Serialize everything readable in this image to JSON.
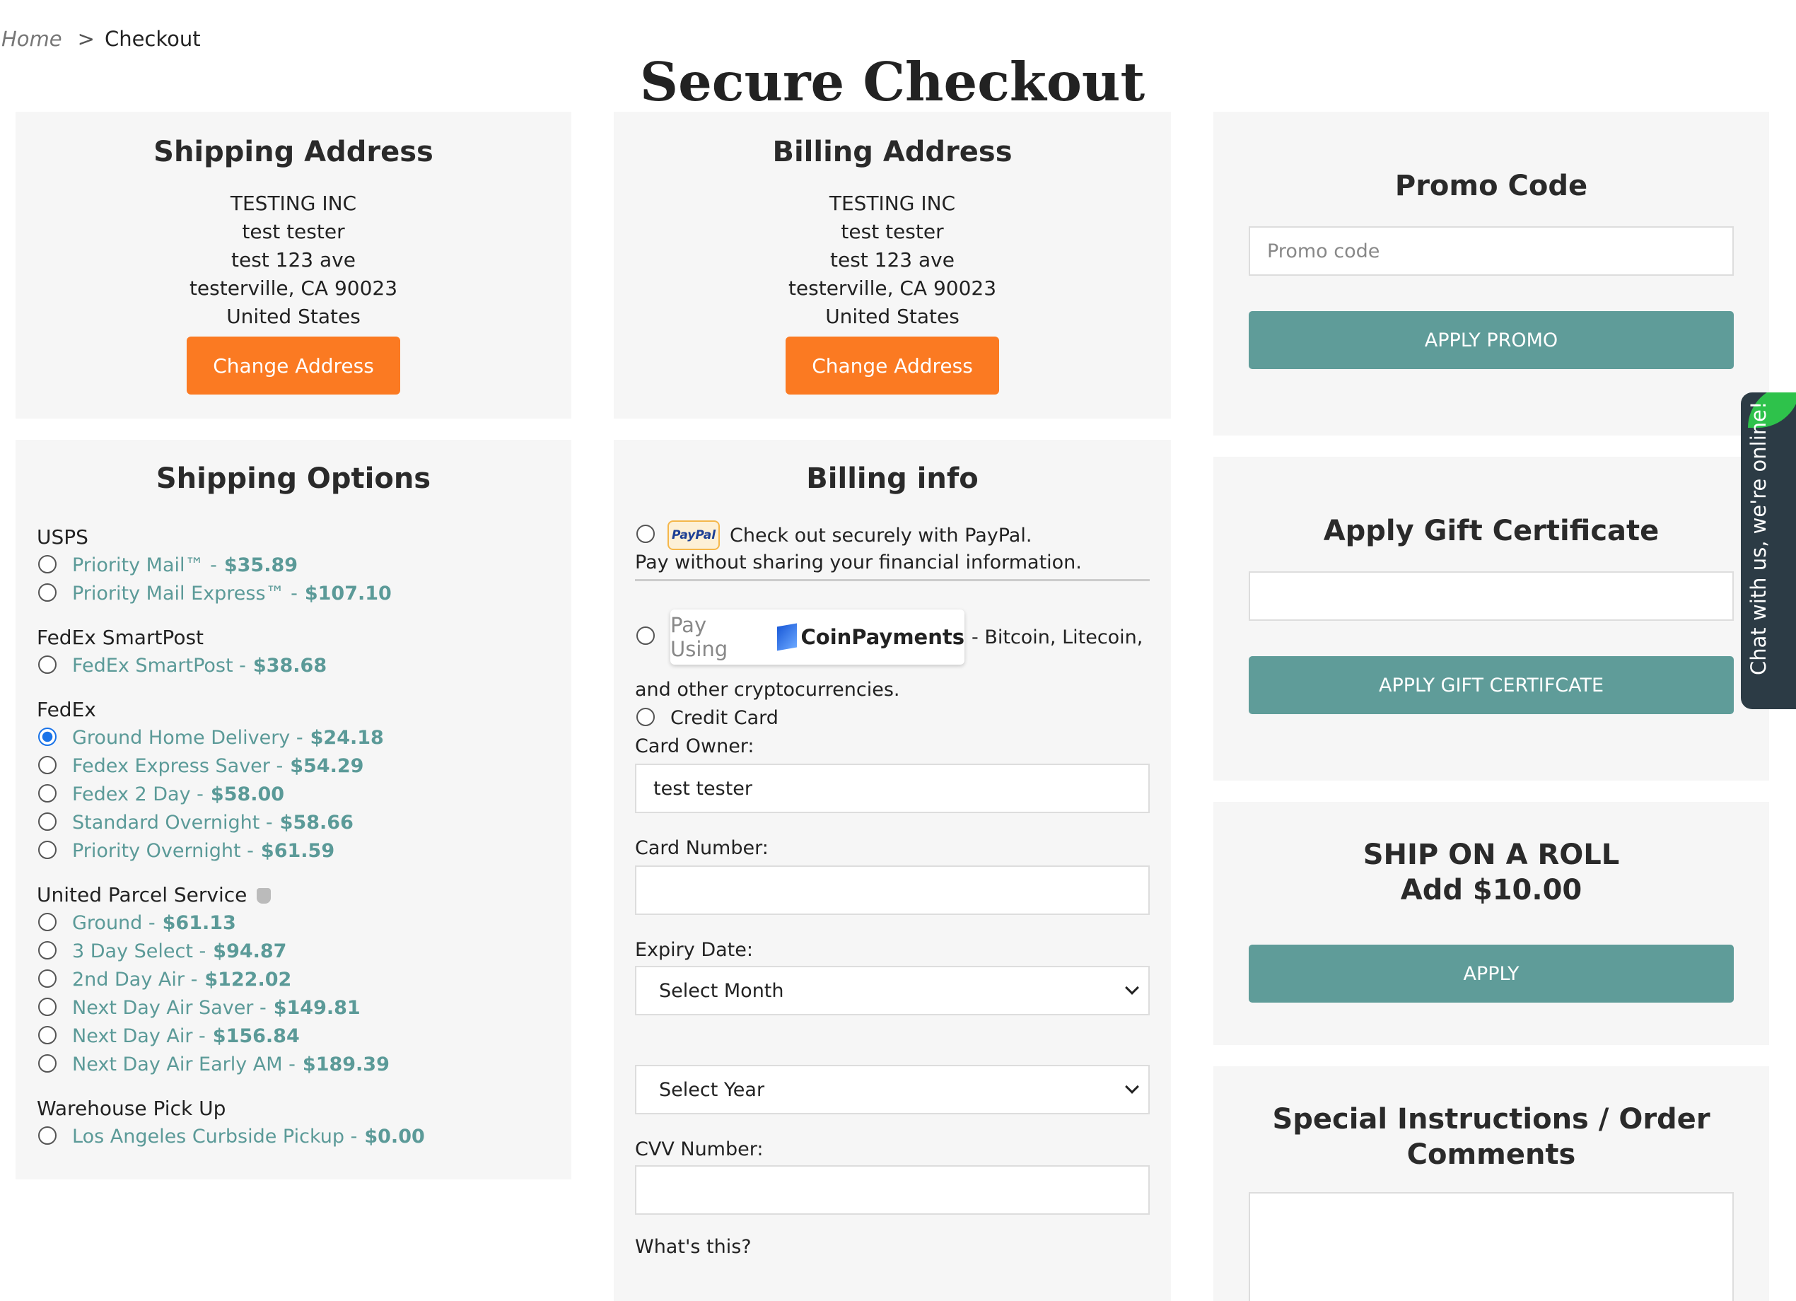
{
  "breadcrumb": {
    "home": "Home",
    "separator": ">",
    "current": "Checkout"
  },
  "page_title": "Secure Checkout",
  "shipping_address": {
    "title": "Shipping Address",
    "lines": [
      "TESTING INC",
      "test tester",
      "test 123 ave",
      "testerville, CA 90023",
      "United States"
    ],
    "button": "Change Address"
  },
  "billing_address": {
    "title": "Billing Address",
    "lines": [
      "TESTING INC",
      "test tester",
      "test 123 ave",
      "testerville, CA 90023",
      "United States"
    ],
    "button": "Change Address"
  },
  "shipping_options": {
    "title": "Shipping Options",
    "groups": [
      {
        "carrier": "USPS",
        "options": [
          {
            "label": "Priority Mail™ - ",
            "price": "$35.89"
          },
          {
            "label": "Priority Mail Express™ - ",
            "price": "$107.10"
          }
        ]
      },
      {
        "carrier": "FedEx SmartPost",
        "options": [
          {
            "label": "FedEx SmartPost - ",
            "price": "$38.68"
          }
        ]
      },
      {
        "carrier": "FedEx",
        "options": [
          {
            "label": "Ground Home Delivery - ",
            "price": "$24.18"
          },
          {
            "label": "Fedex Express Saver - ",
            "price": "$54.29"
          },
          {
            "label": "Fedex 2 Day - ",
            "price": "$58.00"
          },
          {
            "label": "Standard Overnight - ",
            "price": "$58.66"
          },
          {
            "label": "Priority Overnight - ",
            "price": "$61.59"
          }
        ]
      },
      {
        "carrier": "United Parcel Service",
        "options": [
          {
            "label": "Ground - ",
            "price": "$61.13"
          },
          {
            "label": "3 Day Select - ",
            "price": "$94.87"
          },
          {
            "label": "2nd Day Air - ",
            "price": "$122.02"
          },
          {
            "label": "Next Day Air Saver - ",
            "price": "$149.81"
          },
          {
            "label": "Next Day Air - ",
            "price": "$156.84"
          },
          {
            "label": "Next Day Air Early AM - ",
            "price": "$189.39"
          }
        ]
      },
      {
        "carrier": "Warehouse Pick Up",
        "options": [
          {
            "label": "Los Angeles Curbside Pickup - ",
            "price": "$0.00"
          }
        ]
      }
    ],
    "selected": "Ground Home Delivery"
  },
  "billing_info": {
    "title": "Billing info",
    "paypal_badge": "PayPal",
    "paypal_text": "Check out securely with PayPal.",
    "paypal_subtext": "Pay without sharing your financial information.",
    "coin_using": "Pay Using",
    "coin_brand": "CoinPayments",
    "coin_text": "- Bitcoin, Litecoin,",
    "coin_subtext": "and other cryptocurrencies.",
    "credit_card": "Credit Card",
    "card_owner_label": "Card Owner:",
    "card_owner_value": "test tester",
    "card_number_label": "Card Number:",
    "card_number_value": "",
    "expiry_label": "Expiry Date:",
    "month_select": "Select Month",
    "year_select": "Select Year",
    "cvv_label": "CVV Number:",
    "cvv_value": "",
    "whats_this": "What's this?"
  },
  "promo": {
    "title": "Promo Code",
    "placeholder": "Promo code",
    "button": "APPLY PROMO"
  },
  "gift": {
    "title": "Apply Gift Certificate",
    "button": "APPLY GIFT CERTIFCATE"
  },
  "roll": {
    "title_line1": "SHIP ON A ROLL",
    "title_line2": "Add $10.00",
    "button": "APPLY"
  },
  "instructions": {
    "title_line1": "Special Instructions / Order",
    "title_line2": "Comments"
  },
  "chat": {
    "text": "Chat with us, we're online!"
  },
  "colors": {
    "accent_orange": "#fb7a22",
    "teal": "#5f9c99",
    "panel_bg": "#f6f6f6",
    "chat_bg": "#2c3b45",
    "chat_leaf": "#2ec24b"
  },
  "icons": [
    "ups-shield-icon",
    "paypal-logo-icon",
    "coinpayments-logo-icon",
    "chevron-down-icon",
    "chat-leaf-icon"
  ]
}
